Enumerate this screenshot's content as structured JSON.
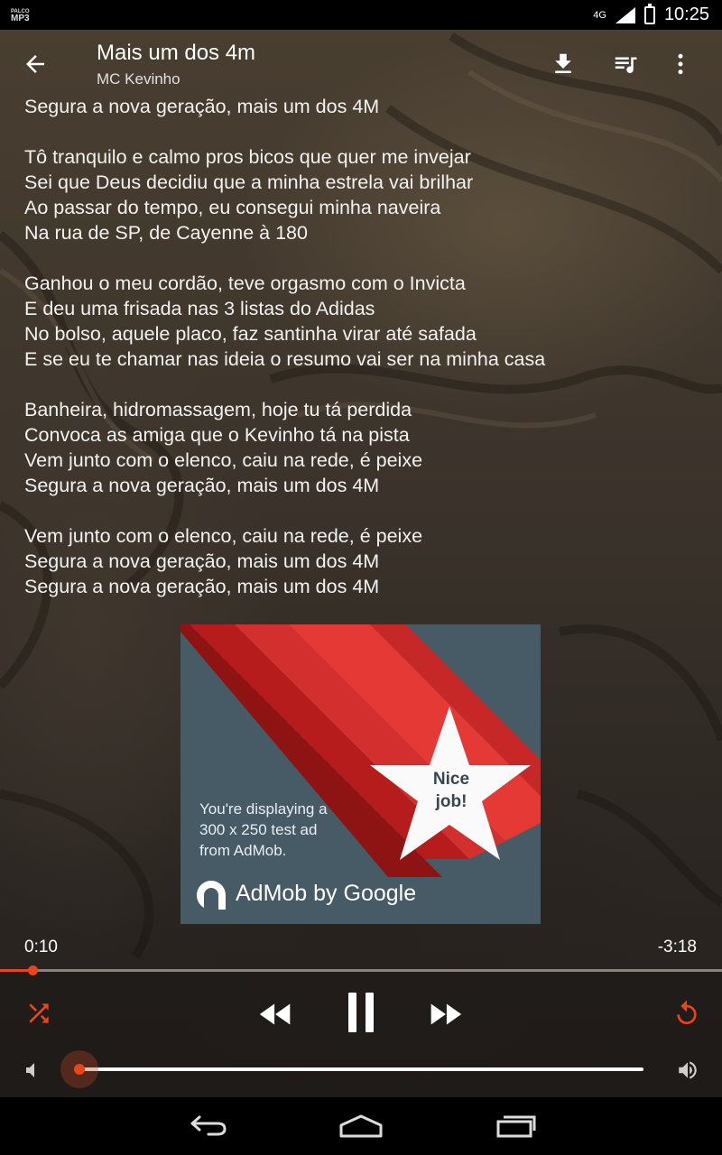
{
  "status_bar": {
    "app_badge_top": "PALCO",
    "app_badge_bottom": "MP3",
    "network": "4G",
    "time": "10:25"
  },
  "header": {
    "title": "Mais um dos 4m",
    "artist": "MC Kevinho",
    "icons": [
      "back-arrow-icon",
      "download-icon",
      "playlist-add-icon",
      "more-vert-icon"
    ]
  },
  "lyrics": [
    "Segura a nova geração, mais um dos 4M",
    "",
    "Tô tranquilo e calmo pros bicos que quer me invejar",
    "Sei que Deus decidiu que a minha estrela vai brilhar",
    "Ao passar do tempo, eu consegui minha naveira",
    "Na rua de SP, de Cayenne à 180",
    "",
    "Ganhou o meu cordão, teve orgasmo com o Invicta",
    "E deu uma frisada nas 3 listas do Adidas",
    "No bolso, aquele placo, faz santinha virar até safada",
    "E se eu te chamar nas ideia o resumo vai ser na minha casa",
    "",
    "Banheira, hidromassagem, hoje tu tá perdida",
    "Convoca as amiga que o Kevinho tá na pista",
    "Vem junto com o elenco, caiu na rede, é peixe",
    "Segura a nova geração, mais um dos 4M",
    "",
    "Vem junto com o elenco, caiu na rede, é peixe",
    "Segura a nova geração, mais um dos 4M",
    "Segura a nova geração, mais um dos 4M"
  ],
  "ad": {
    "badge_line1": "Nice",
    "badge_line2": "job!",
    "text_line1": "You're displaying a",
    "text_line2": "300 x 250 test ad",
    "text_line3": "from AdMob.",
    "brand": "AdMob by Google"
  },
  "player": {
    "elapsed": "0:10",
    "remaining": "-3:18",
    "progress_fraction": 0.045,
    "volume_fraction": 0.0,
    "accent_color": "#e8451a",
    "controls": [
      "shuffle-icon",
      "rewind-icon",
      "pause-icon",
      "fast-forward-icon",
      "repeat-icon",
      "volume-low-icon",
      "volume-high-icon"
    ]
  },
  "nav_bar": {
    "buttons": [
      "back-nav-icon",
      "home-nav-icon",
      "recents-nav-icon"
    ]
  }
}
